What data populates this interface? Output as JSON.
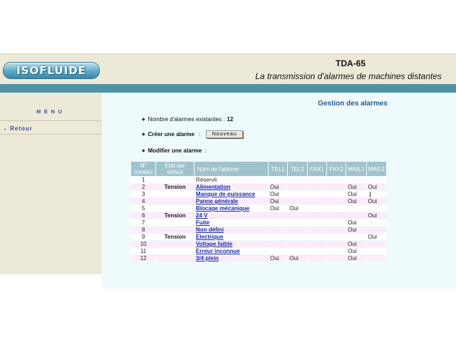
{
  "header": {
    "logo_text": "ISOFLUIDE",
    "title": "TDA-65",
    "subtitle": "La transmission d'alarmes de machines distantes"
  },
  "sidebar": {
    "menu_title": "MENU",
    "items": [
      {
        "label": "Retour"
      }
    ]
  },
  "main": {
    "page_title": "Gestion des alarmes",
    "count_label": "Nombre d'alarmes existantes :",
    "count_value": "12",
    "create_label": "Créer une alarme",
    "create_sep": ":",
    "new_button": "Nouveau",
    "modify_label": "Modifier une alarme",
    "modify_sep": ":"
  },
  "table": {
    "headers": {
      "contact": "N° contact",
      "state": "Etat par défaut",
      "name": "Nom de l'alarme",
      "tel1": "TEL1",
      "tel2": "TEL2",
      "fax1": "FAX1",
      "fax2": "FAX2",
      "mail1": "MAIL1",
      "mail2": "MAIL2"
    },
    "rows": [
      {
        "num": "1",
        "state": "",
        "name": "Réservé",
        "link": false,
        "tel1": "",
        "tel2": "",
        "fax1": "",
        "fax2": "",
        "mail1": "",
        "mail2": ""
      },
      {
        "num": "2",
        "state": "Tension",
        "name": "Alimentation",
        "link": true,
        "tel1": "Oui",
        "tel2": "",
        "fax1": "",
        "fax2": "",
        "mail1": "Oui",
        "mail2": "Oui"
      },
      {
        "num": "3",
        "state": "",
        "name": "Manque de puissance",
        "link": true,
        "tel1": "Oui",
        "tel2": "",
        "fax1": "",
        "fax2": "",
        "mail1": "Oui",
        "mail2": ""
      },
      {
        "num": "4",
        "state": "",
        "name": "Panne générale",
        "link": true,
        "tel1": "Oui",
        "tel2": "",
        "fax1": "",
        "fax2": "",
        "mail1": "Oui",
        "mail2": "Oui"
      },
      {
        "num": "5",
        "state": "",
        "name": "Blocage mécanique",
        "link": true,
        "tel1": "Oui",
        "tel2": "Oui",
        "fax1": "",
        "fax2": "",
        "mail1": "",
        "mail2": ""
      },
      {
        "num": "6",
        "state": "Tension",
        "name": "24 V",
        "link": true,
        "tel1": "",
        "tel2": "",
        "fax1": "",
        "fax2": "",
        "mail1": "",
        "mail2": "Oui"
      },
      {
        "num": "7",
        "state": "",
        "name": "Fuite",
        "link": true,
        "tel1": "",
        "tel2": "",
        "fax1": "",
        "fax2": "",
        "mail1": "Oui",
        "mail2": ""
      },
      {
        "num": "8",
        "state": "",
        "name": "Non défini",
        "link": true,
        "tel1": "",
        "tel2": "",
        "fax1": "",
        "fax2": "",
        "mail1": "Oui",
        "mail2": ""
      },
      {
        "num": "9",
        "state": "Tension",
        "name": "Electrique",
        "link": true,
        "tel1": "",
        "tel2": "",
        "fax1": "",
        "fax2": "",
        "mail1": "",
        "mail2": "Oui"
      },
      {
        "num": "10",
        "state": "",
        "name": "Voltage faible",
        "link": true,
        "tel1": "",
        "tel2": "",
        "fax1": "",
        "fax2": "",
        "mail1": "Oui",
        "mail2": ""
      },
      {
        "num": "11",
        "state": "",
        "name": "Erreur inconnue",
        "link": true,
        "tel1": "",
        "tel2": "",
        "fax1": "",
        "fax2": "",
        "mail1": "Oui",
        "mail2": ""
      },
      {
        "num": "12",
        "state": "",
        "name": "3/4 plein",
        "link": true,
        "tel1": "Oui",
        "tel2": "Oui",
        "fax1": "",
        "fax2": "",
        "mail1": "Oui",
        "mail2": ""
      }
    ]
  },
  "colors": {
    "header_bg": "#ede9d8",
    "teal_bar": "#4d93a5",
    "content_bg": "#effafd",
    "table_header": "#9fc3cc",
    "row_alt": "#fcebf8",
    "link": "#1a2aa8"
  }
}
